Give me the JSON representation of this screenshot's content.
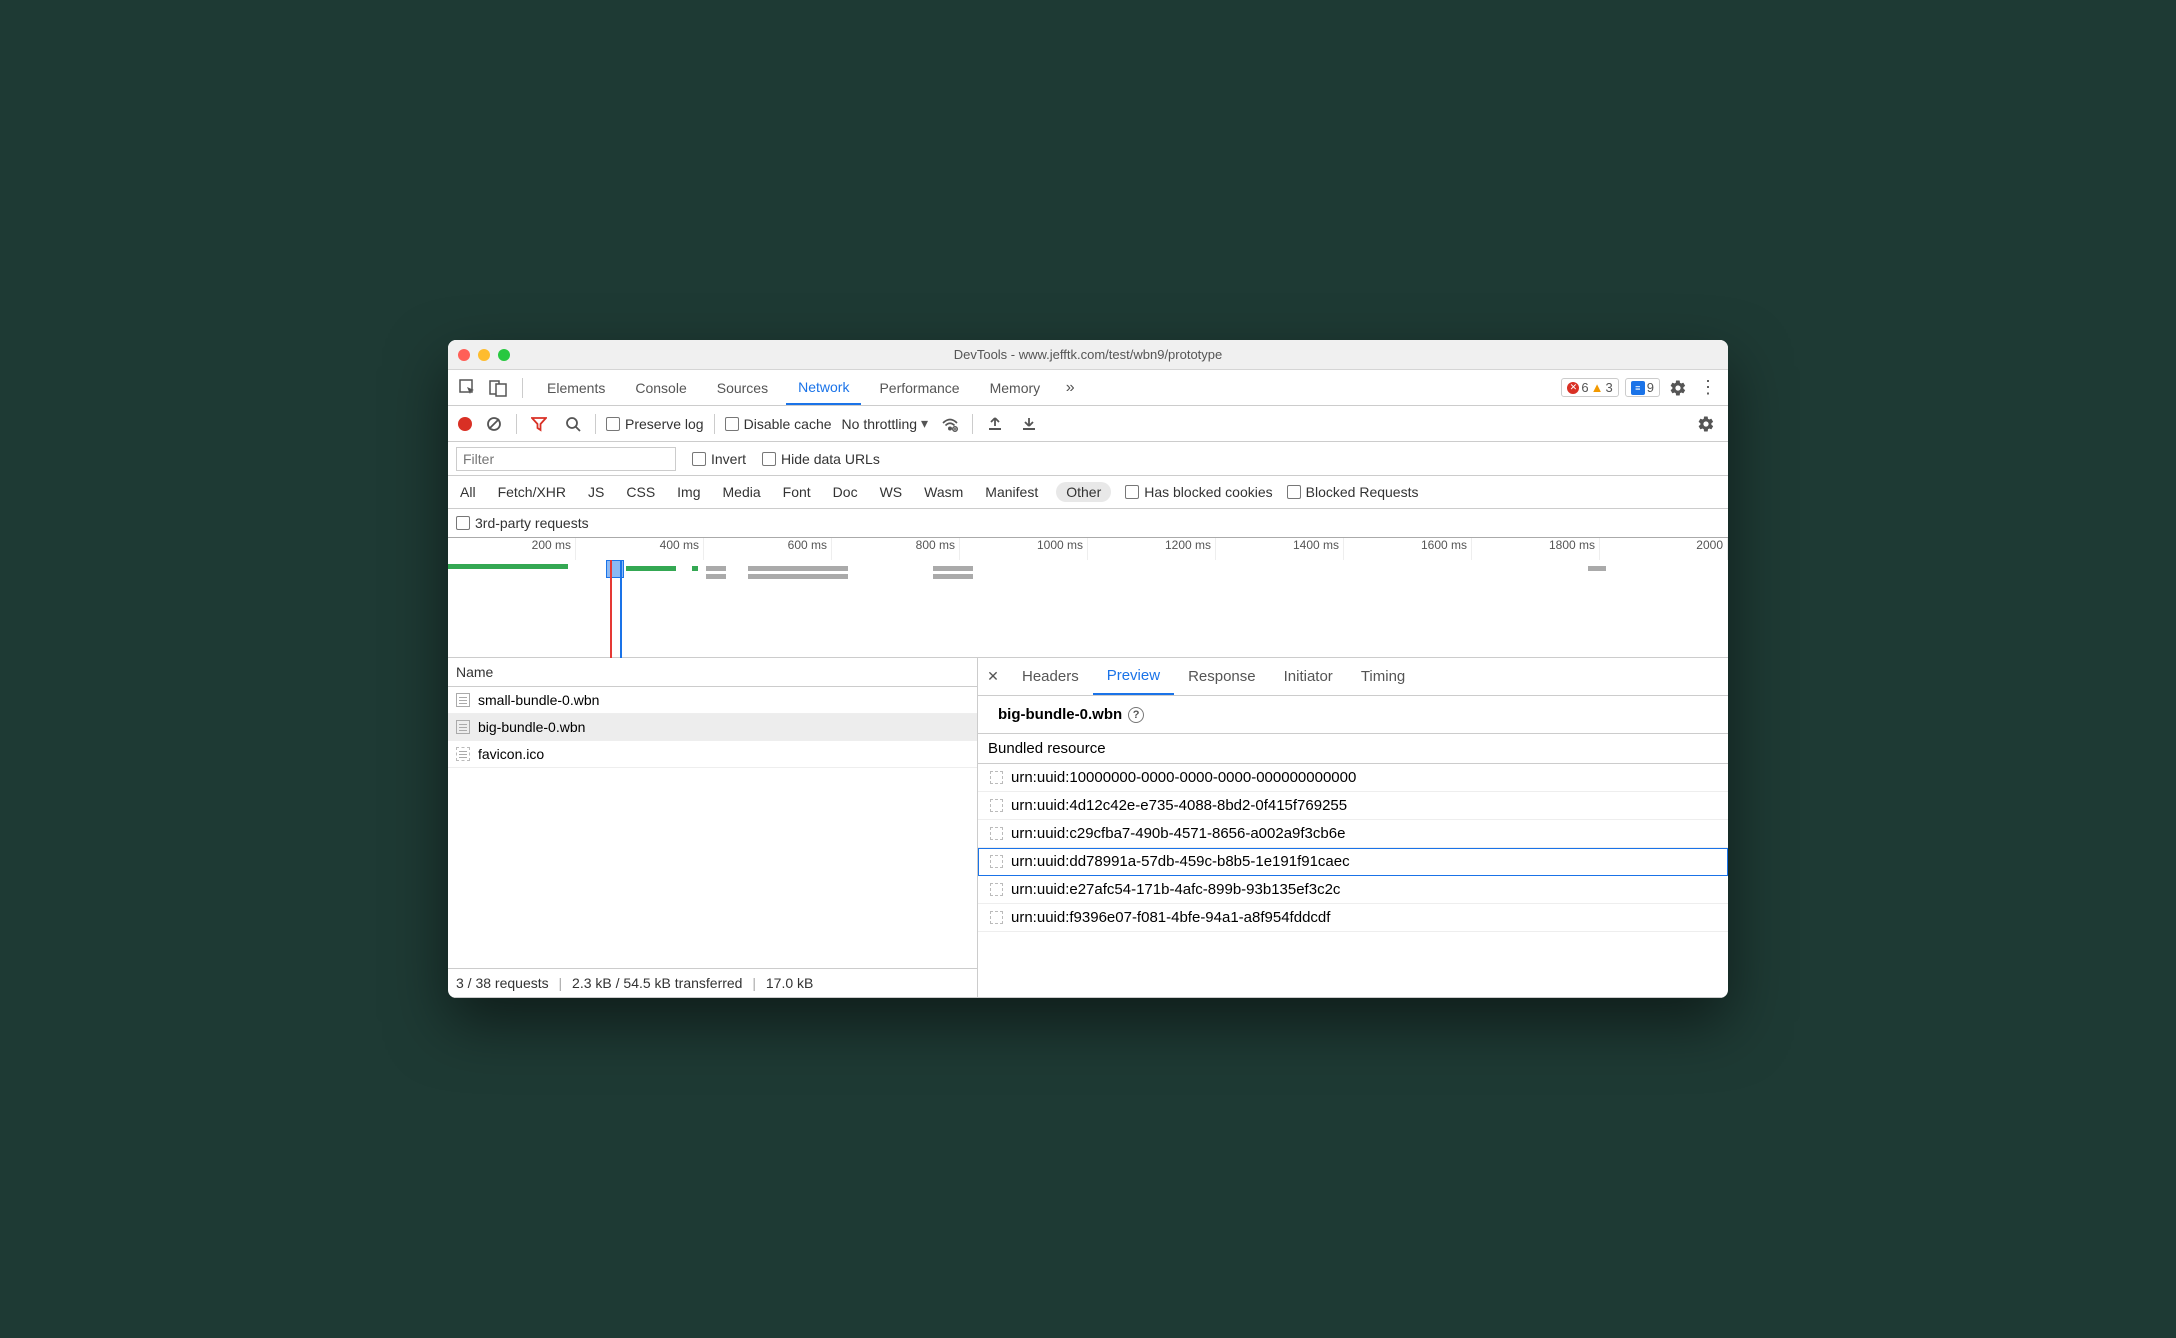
{
  "window": {
    "title": "DevTools - www.jefftk.com/test/wbn9/prototype"
  },
  "tabs": {
    "items": [
      "Elements",
      "Console",
      "Sources",
      "Network",
      "Performance",
      "Memory"
    ],
    "active": "Network",
    "more_icon": "»",
    "errors": "6",
    "warnings": "3",
    "messages": "9"
  },
  "toolbar": {
    "preserve_log": "Preserve log",
    "disable_cache": "Disable cache",
    "throttling": "No throttling"
  },
  "filterbar": {
    "filter_placeholder": "Filter",
    "invert": "Invert",
    "hide_data_urls": "Hide data URLs"
  },
  "typebar": {
    "types": [
      "All",
      "Fetch/XHR",
      "JS",
      "CSS",
      "Img",
      "Media",
      "Font",
      "Doc",
      "WS",
      "Wasm",
      "Manifest",
      "Other"
    ],
    "selected": "Other",
    "has_blocked_cookies": "Has blocked cookies",
    "blocked_requests": "Blocked Requests",
    "third_party": "3rd-party requests"
  },
  "timeline": {
    "ticks": [
      "200 ms",
      "400 ms",
      "600 ms",
      "800 ms",
      "1000 ms",
      "1200 ms",
      "1400 ms",
      "1600 ms",
      "1800 ms",
      "2000 "
    ]
  },
  "leftpane": {
    "col_name": "Name",
    "requests": [
      {
        "name": "small-bundle-0.wbn",
        "selected": false,
        "unknown": false
      },
      {
        "name": "big-bundle-0.wbn",
        "selected": true,
        "unknown": false
      },
      {
        "name": "favicon.ico",
        "selected": false,
        "unknown": true
      }
    ],
    "status": {
      "requests": "3 / 38 requests",
      "transferred": "2.3 kB / 54.5 kB transferred",
      "size": "17.0 kB "
    }
  },
  "rightpane": {
    "detail_tabs": [
      "Headers",
      "Preview",
      "Response",
      "Initiator",
      "Timing"
    ],
    "active_tab": "Preview",
    "preview_title": "big-bundle-0.wbn",
    "section": "Bundled resource",
    "resources": [
      "urn:uuid:10000000-0000-0000-0000-000000000000",
      "urn:uuid:4d12c42e-e735-4088-8bd2-0f415f769255",
      "urn:uuid:c29cfba7-490b-4571-8656-a002a9f3cb6e",
      "urn:uuid:dd78991a-57db-459c-b8b5-1e191f91caec",
      "urn:uuid:e27afc54-171b-4afc-899b-93b135ef3c2c",
      "urn:uuid:f9396e07-f081-4bfe-94a1-a8f954fddcdf"
    ],
    "selected_resource_index": 3
  }
}
